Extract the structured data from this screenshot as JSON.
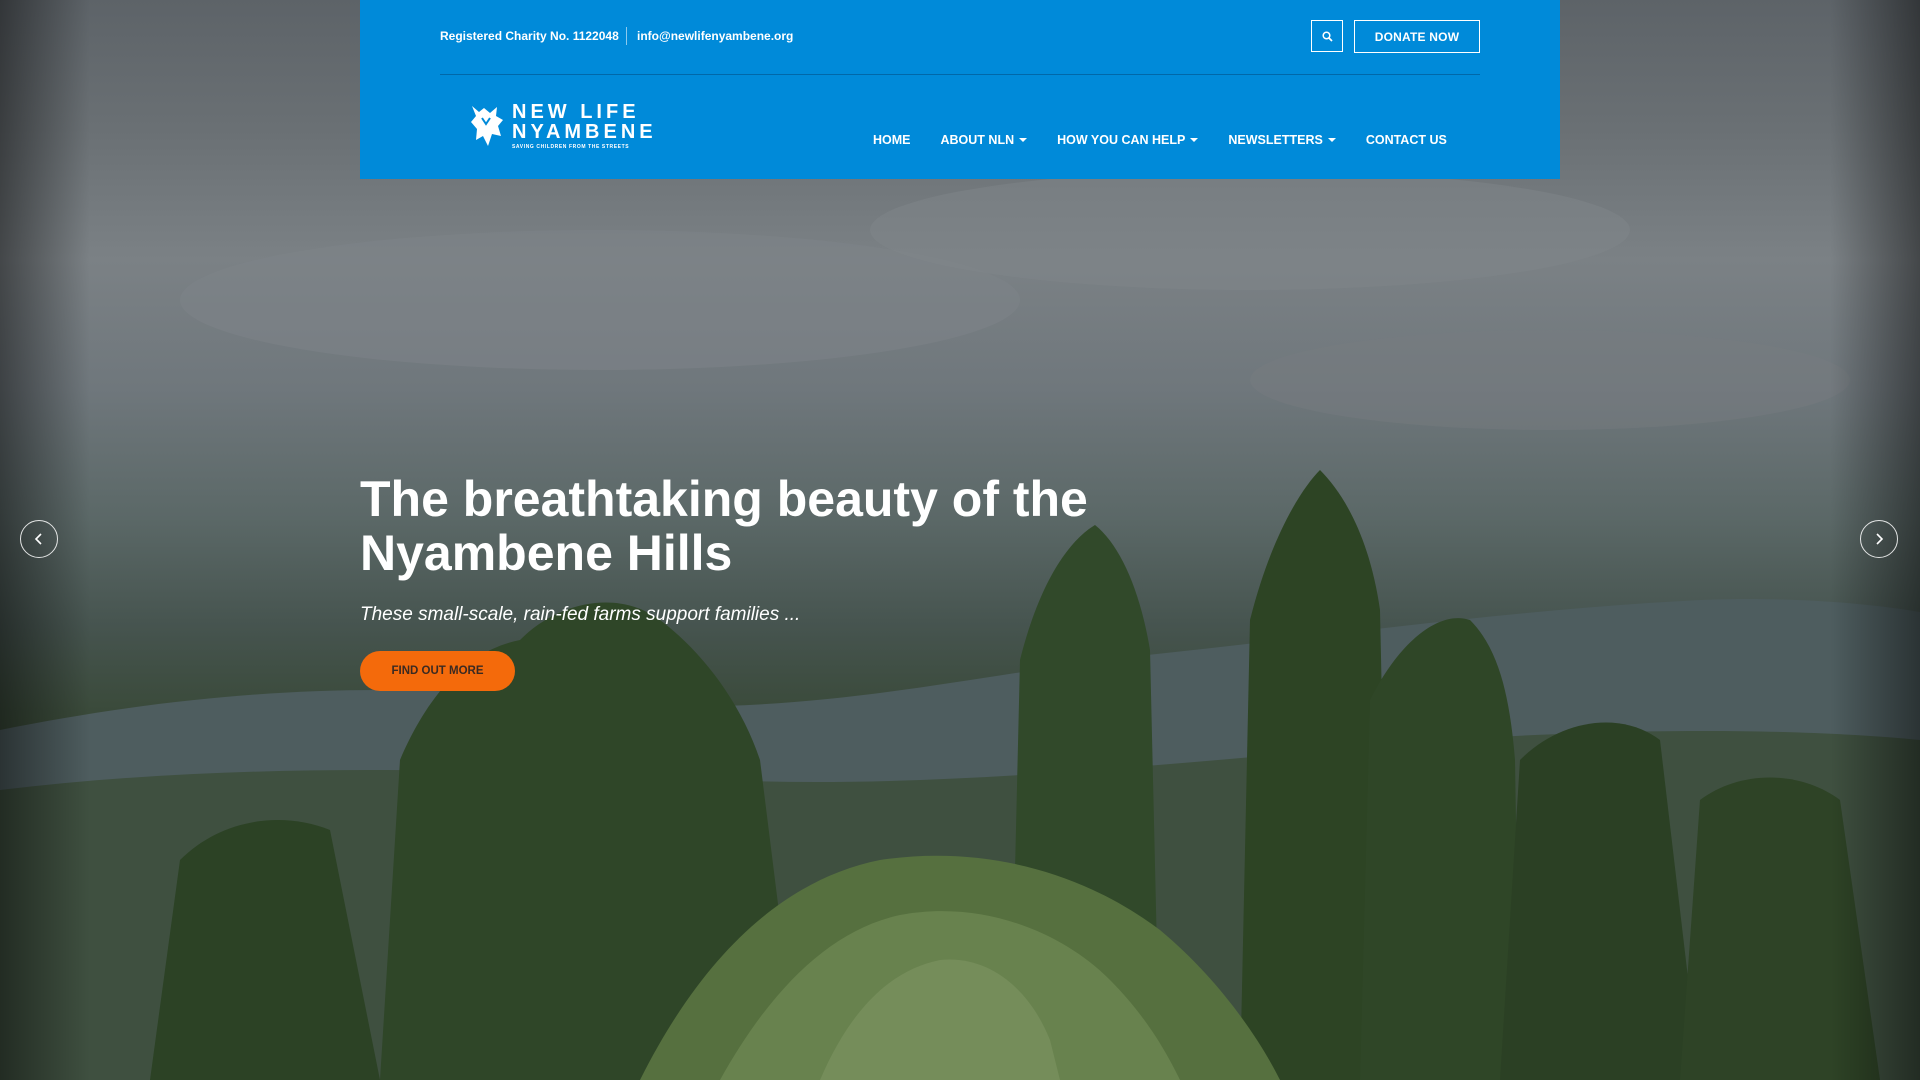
{
  "topbar": {
    "charity_text": "Registered Charity No. 1122048",
    "email": "info@newlifenyambene.org",
    "search_icon": "search-icon",
    "donate_label": "DONATE NOW"
  },
  "logo": {
    "line1": "NEW LIFE",
    "line2": "NYAMBENE",
    "tagline": "SAVING CHILDREN FROM THE STREETS"
  },
  "nav": {
    "items": [
      {
        "label": "HOME",
        "dropdown": false
      },
      {
        "label": "ABOUT NLN",
        "dropdown": true
      },
      {
        "label": "HOW YOU CAN HELP",
        "dropdown": true
      },
      {
        "label": "NEWSLETTERS",
        "dropdown": true
      },
      {
        "label": "CONTACT US",
        "dropdown": false
      }
    ]
  },
  "slide": {
    "title_line1": "The breathtaking beauty of the",
    "title_line2": "Nyambene Hills",
    "subtitle": "These small-scale, rain-fed farms support families ...",
    "cta_label": "FIND OUT MORE"
  },
  "carousel": {
    "prev_icon": "chevron-left-icon",
    "next_icon": "chevron-right-icon"
  },
  "colors": {
    "header_blue": "#008ad9",
    "cta_orange": "#f46a0b"
  }
}
